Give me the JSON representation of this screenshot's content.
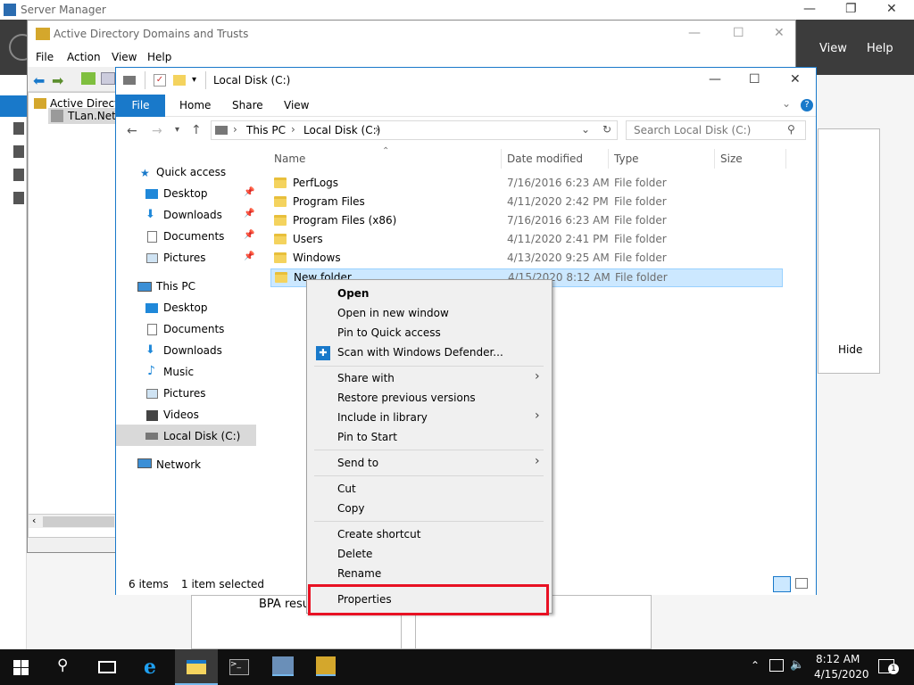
{
  "server_manager": {
    "title": "Server Manager",
    "menu": [
      "View",
      "Help"
    ],
    "hide_label": "Hide",
    "bpa_label": "BPA resu"
  },
  "ad_window": {
    "title": "Active Directory Domains and Trusts",
    "menu": [
      "File",
      "Action",
      "View",
      "Help"
    ],
    "tree": {
      "root": "Active Directo",
      "child": "TLan.Net"
    }
  },
  "explorer": {
    "title": "Local Disk (C:)",
    "ribbon_tabs": [
      "File",
      "Home",
      "Share",
      "View"
    ],
    "breadcrumb": [
      "This PC",
      "Local Disk (C:)"
    ],
    "search_placeholder": "Search Local Disk (C:)",
    "columns": [
      "Name",
      "Date modified",
      "Type",
      "Size"
    ],
    "files": [
      {
        "name": "PerfLogs",
        "date": "7/16/2016 6:23 AM",
        "type": "File folder"
      },
      {
        "name": "Program Files",
        "date": "4/11/2020 2:42 PM",
        "type": "File folder"
      },
      {
        "name": "Program Files (x86)",
        "date": "7/16/2016 6:23 AM",
        "type": "File folder"
      },
      {
        "name": "Users",
        "date": "4/11/2020 2:41 PM",
        "type": "File folder"
      },
      {
        "name": "Windows",
        "date": "4/13/2020 9:25 AM",
        "type": "File folder"
      },
      {
        "name": "New folder",
        "date": "4/15/2020 8:12 AM",
        "type": "File folder"
      }
    ],
    "nav": {
      "quick_access": "Quick access",
      "quick_items": [
        "Desktop",
        "Downloads",
        "Documents",
        "Pictures"
      ],
      "this_pc": "This PC",
      "pc_items": [
        "Desktop",
        "Documents",
        "Downloads",
        "Music",
        "Pictures",
        "Videos",
        "Local Disk (C:)"
      ],
      "network": "Network"
    },
    "status": {
      "items": "6 items",
      "selected": "1 item selected"
    }
  },
  "context_menu": {
    "group1": [
      "Open",
      "Open in new window",
      "Pin to Quick access",
      "Scan with Windows Defender..."
    ],
    "group2": [
      "Share with",
      "Restore previous versions",
      "Include in library",
      "Pin to Start"
    ],
    "group3": [
      "Send to"
    ],
    "group4": [
      "Cut",
      "Copy"
    ],
    "group5": [
      "Create shortcut",
      "Delete",
      "Rename"
    ],
    "group6": [
      "Properties"
    ],
    "highlight_color": "#e81123"
  },
  "taskbar": {
    "time": "8:12 AM",
    "date": "4/15/2020",
    "notification_count": "1"
  },
  "colors": {
    "accent": "#1979ca",
    "selection": "#cce8ff",
    "taskbar": "#101010"
  }
}
